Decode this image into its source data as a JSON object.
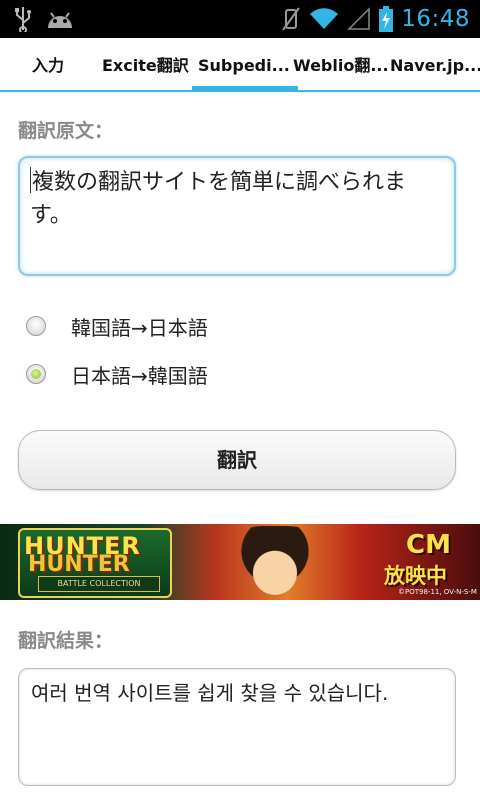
{
  "status_bar": {
    "time": "16:48",
    "left_icons": [
      "usb-icon",
      "android-icon"
    ],
    "right_icons": [
      "vibrate-off-icon",
      "wifi-icon",
      "signal-icon",
      "battery-charging-icon"
    ],
    "accent_color": "#33b5e5"
  },
  "tabs": [
    {
      "label": "入力",
      "active": false
    },
    {
      "label": "Excite翻訳",
      "active": false
    },
    {
      "label": "Subpedi...",
      "active": true
    },
    {
      "label": "Weblio翻...",
      "active": false
    },
    {
      "label": "Naver.jp...",
      "active": false
    }
  ],
  "source": {
    "label": "翻訳原文：",
    "text": "複数の翻訳サイトを簡単に調べられます。"
  },
  "directions": [
    {
      "label": "韓国語→日本語",
      "checked": false
    },
    {
      "label": "日本語→韓国語",
      "checked": true
    }
  ],
  "translate_button": "翻訳",
  "banner": {
    "logo_line1": "HUNTER",
    "logo_line2": "HUNTER",
    "logo_sub": "BATTLE COLLECTION",
    "cm": "CM",
    "on_air": "放映中",
    "copyright": "©POT98-11, OV-N-S-M"
  },
  "result": {
    "label": "翻訳結果：",
    "text": "여러 번역 사이트를 쉽게 찾을 수 있습니다."
  }
}
